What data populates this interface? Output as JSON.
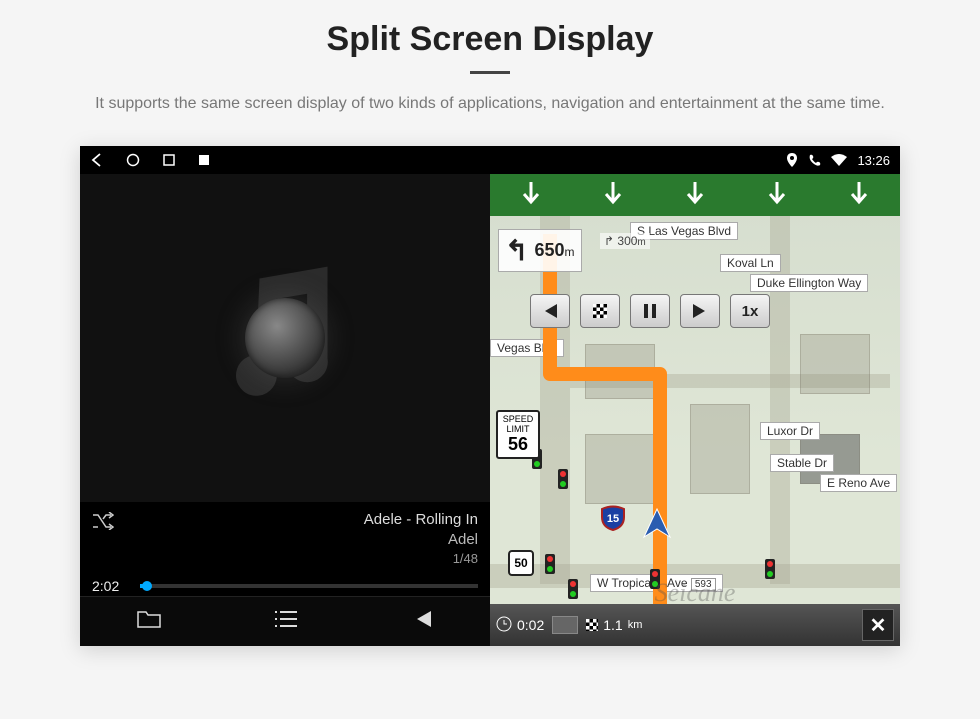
{
  "header": {
    "title": "Split Screen Display",
    "subtitle": "It supports the same screen display of two kinds of applications, navigation and entertainment at the same time."
  },
  "status": {
    "time": "13:26"
  },
  "music": {
    "track_line1": "Adele - Rolling In",
    "track_line2": "Adel",
    "counter": "1/48",
    "elapsed": "2:02"
  },
  "nav": {
    "streets": {
      "top": "S Las Vegas Blvd",
      "right1": "Koval Ln",
      "right2": "Duke Ellington Way",
      "right3": "Luxor Dr",
      "right4": "Stable Dr",
      "right5": "E Reno Ave",
      "left1": "Vegas Blvd",
      "bottom": "W Tropicana Ave",
      "bottom_num": "593"
    },
    "turn_distance_value": "650",
    "turn_distance_unit": "m",
    "next_turn_value": "300",
    "next_turn_unit": "m",
    "playback_speed": "1x",
    "speed_limit_label": "SPEED LIMIT",
    "speed_limit_value": "56",
    "route": "50",
    "interstate": "15",
    "bottom": {
      "time": "0:02",
      "dist_value": "1.1",
      "dist_unit": "km"
    }
  },
  "watermark": "Seicane"
}
